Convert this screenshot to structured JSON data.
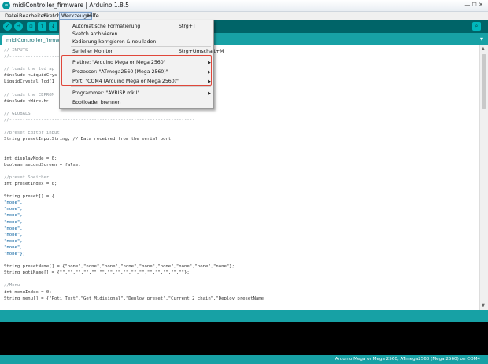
{
  "window": {
    "title": "midiController_firmware | Arduino 1.8.5",
    "app_icon": "∞",
    "controls": "—  ☐  ✕"
  },
  "menubar": {
    "items": [
      "Datei",
      "Bearbeiten",
      "Sketch",
      "Werkzeuge",
      "Hilfe"
    ]
  },
  "toolbar": {
    "verify_icon": "✓",
    "upload_icon": "→",
    "new_icon": "▫",
    "open_icon": "↑",
    "save_icon": "↓",
    "serial_icon": "⌕"
  },
  "tabs": {
    "active": "midiController_firmware",
    "menu_arrow": "▾"
  },
  "code_lines": [
    {
      "t": "// INPUTS",
      "c": "comment"
    },
    {
      "t": "//----------------------------------------------------------------------",
      "c": "comment"
    },
    {
      "t": "",
      "c": "plain"
    },
    {
      "t": "// loads the lcd ap",
      "c": "comment"
    },
    {
      "t": "#include <LiquidCrys",
      "c": "plain"
    },
    {
      "t": "LiquidCrystal lcd(1",
      "c": "plain"
    },
    {
      "t": "",
      "c": "plain"
    },
    {
      "t": "// loads the EEPROM",
      "c": "comment"
    },
    {
      "t": "#include <Wire.h>",
      "c": "plain"
    },
    {
      "t": "",
      "c": "plain"
    },
    {
      "t": "// GLOBALS",
      "c": "comment"
    },
    {
      "t": "//----------------------------------------------------------------------",
      "c": "comment"
    },
    {
      "t": "",
      "c": "plain"
    },
    {
      "t": "//preset Editor input",
      "c": "comment"
    },
    {
      "t": "String presetInputString; // Data received from the serial port",
      "c": "plain"
    },
    {
      "t": "",
      "c": "plain"
    },
    {
      "t": "",
      "c": "plain"
    },
    {
      "t": "int displayMode = 0;",
      "c": "plain"
    },
    {
      "t": "boolean secondScreen = false;",
      "c": "plain"
    },
    {
      "t": "",
      "c": "plain"
    },
    {
      "t": "//preset Speicher",
      "c": "comment"
    },
    {
      "t": "int presetIndex = 0;",
      "c": "plain"
    },
    {
      "t": "",
      "c": "plain"
    },
    {
      "t": "String preset[] = {",
      "c": "plain"
    },
    {
      "t": "\"none\",",
      "c": "str"
    },
    {
      "t": "\"none\",",
      "c": "str"
    },
    {
      "t": "\"none\",",
      "c": "str"
    },
    {
      "t": "\"none\",",
      "c": "str"
    },
    {
      "t": "\"none\",",
      "c": "str"
    },
    {
      "t": "\"none\",",
      "c": "str"
    },
    {
      "t": "\"none\",",
      "c": "str"
    },
    {
      "t": "\"none\",",
      "c": "str"
    },
    {
      "t": "\"none\"};",
      "c": "str"
    },
    {
      "t": "",
      "c": "plain"
    },
    {
      "t": "String presetName[] = {\"none\",\"none\",\"none\",\"none\",\"none\",\"none\",\"none\",\"none\",\"none\"};",
      "c": "plain"
    },
    {
      "t": "String potiName[] = {\"\",\"\",\"\",\"\",\"\",\"\",\"\",\"\",\"\",\"\",\"\",\"\",\"\",\"\",\"\",\"\"};",
      "c": "plain"
    },
    {
      "t": "",
      "c": "plain"
    },
    {
      "t": "//Menu",
      "c": "comment"
    },
    {
      "t": "int menuIndex = 0;",
      "c": "plain"
    },
    {
      "t": "String menu[] = {\"Poti Test\",\"Get Midisignal\",\"Deploy preset\",\"Current 2 chain\",\"Deploy presetName",
      "c": "plain"
    }
  ],
  "dropdown": {
    "items": [
      {
        "label": "Automatische Formatierung",
        "shortcut": "Strg+T",
        "sub": ""
      },
      {
        "label": "Sketch archivieren",
        "shortcut": "",
        "sub": ""
      },
      {
        "label": "Kodierung korrigieren & neu laden",
        "shortcut": "",
        "sub": ""
      },
      {
        "label": "Serieller Monitor",
        "shortcut": "Strg+Umschalt+M",
        "sub": ""
      },
      {
        "label": "Platine: \"Arduino Mega or Mega 2560\"",
        "shortcut": "",
        "sub": "▶"
      },
      {
        "label": "Prozessor: \"ATmega2560 (Mega 2560)\"",
        "shortcut": "",
        "sub": "▶"
      },
      {
        "label": "Port: \"COM4 (Arduino Mega or Mega 2560)\"",
        "shortcut": "",
        "sub": "▶"
      },
      {
        "label": "Programmer: \"AVRISP mkII\"",
        "shortcut": "",
        "sub": "▶"
      },
      {
        "label": "Bootloader brennen",
        "shortcut": "",
        "sub": ""
      }
    ]
  },
  "footer": {
    "board_info": "Arduino Mega or Mega 2560, ATmega2560 (Mega 2560) on COM4"
  },
  "colors": {
    "toolbar": "#006468",
    "tabbar": "#17a1a5",
    "highlight": "#e0473a"
  }
}
